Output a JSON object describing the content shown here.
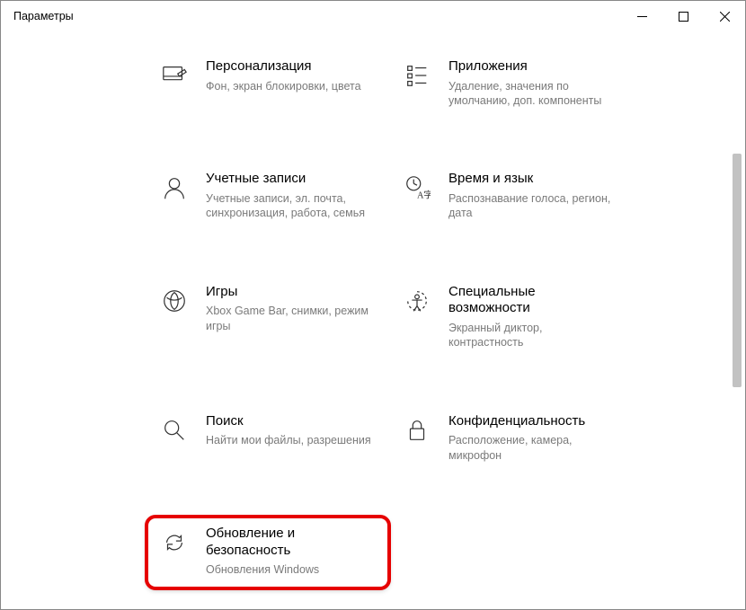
{
  "window": {
    "title": "Параметры"
  },
  "tiles": [
    {
      "title": "Персонализация",
      "desc": "Фон, экран блокировки, цвета"
    },
    {
      "title": "Приложения",
      "desc": "Удаление, значения по умолчанию, доп. компоненты"
    },
    {
      "title": "Учетные записи",
      "desc": "Учетные записи, эл. почта, синхронизация, работа, семья"
    },
    {
      "title": "Время и язык",
      "desc": "Распознавание голоса, регион, дата"
    },
    {
      "title": "Игры",
      "desc": "Xbox Game Bar, снимки, режим игры"
    },
    {
      "title": "Специальные возможности",
      "desc": "Экранный диктор, контрастность"
    },
    {
      "title": "Поиск",
      "desc": "Найти мои файлы, разрешения"
    },
    {
      "title": "Конфиденциальность",
      "desc": "Расположение, камера, микрофон"
    },
    {
      "title": "Обновление и безопасность",
      "desc": "Обновления Windows"
    }
  ]
}
